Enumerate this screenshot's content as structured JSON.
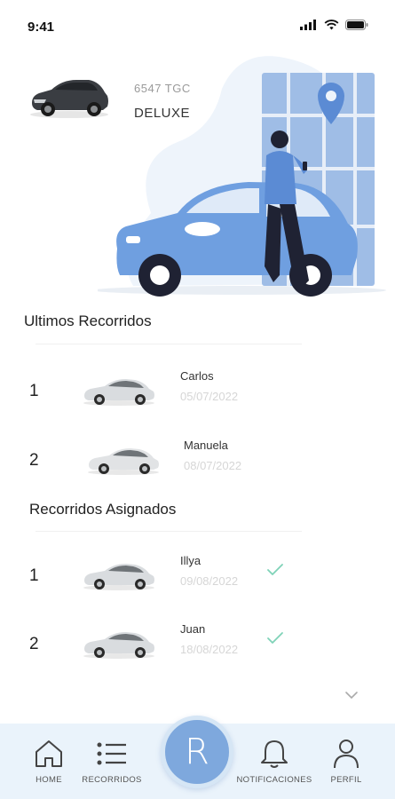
{
  "status_bar": {
    "time": "9:41"
  },
  "vehicle": {
    "plate": "6547 TGC",
    "model": "DELUXE"
  },
  "recent": {
    "title": "Ultimos Recorridos",
    "items": [
      {
        "num": "1",
        "name": "Carlos",
        "date": "05/07/2022"
      },
      {
        "num": "2",
        "name": "Manuela",
        "date": "08/07/2022"
      }
    ]
  },
  "assigned": {
    "title": "Recorridos Asignados",
    "items": [
      {
        "num": "1",
        "name": "Illya",
        "date": "09/08/2022",
        "status_icon": "check-icon"
      },
      {
        "num": "2",
        "name": "Juan",
        "date": "18/08/2022",
        "status_icon": "check-icon"
      }
    ]
  },
  "nav": {
    "home": "HOME",
    "recorridos": "RECORRIDOS",
    "center": "R",
    "notificaciones": "NOTIFICACIONES",
    "perfil": "PERFIL"
  },
  "colors": {
    "accent": "#7ea8dd",
    "nav_bg": "#eaf3fb",
    "check": "#7fd3b8"
  }
}
